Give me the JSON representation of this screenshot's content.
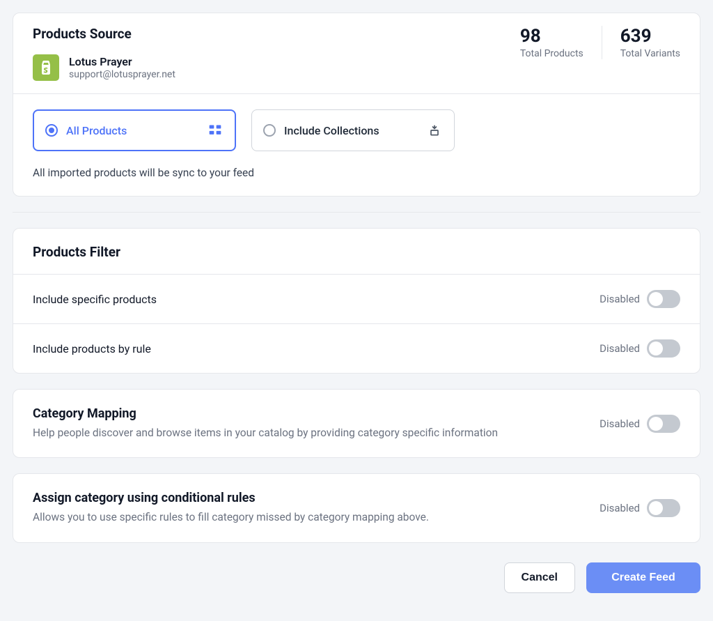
{
  "source": {
    "title": "Products Source",
    "store": {
      "name": "Lotus Prayer",
      "email": "support@lotusprayer.net"
    },
    "stats": {
      "products_value": "98",
      "products_label": "Total Products",
      "variants_value": "639",
      "variants_label": "Total Variants"
    },
    "options": {
      "all_products": "All Products",
      "include_collections": "Include Collections"
    },
    "hint": "All imported products will be sync to your feed"
  },
  "filter": {
    "title": "Products Filter",
    "rows": [
      {
        "label": "Include specific products",
        "state": "Disabled"
      },
      {
        "label": "Include products by rule",
        "state": "Disabled"
      }
    ]
  },
  "category_mapping": {
    "title": "Category Mapping",
    "desc": "Help people discover and browse items in your catalog by providing category specific information",
    "state": "Disabled"
  },
  "conditional_rules": {
    "title": "Assign category using conditional rules",
    "desc": "Allows you to use specific rules to fill category missed by category mapping above.",
    "state": "Disabled"
  },
  "footer": {
    "cancel": "Cancel",
    "create": "Create Feed"
  }
}
